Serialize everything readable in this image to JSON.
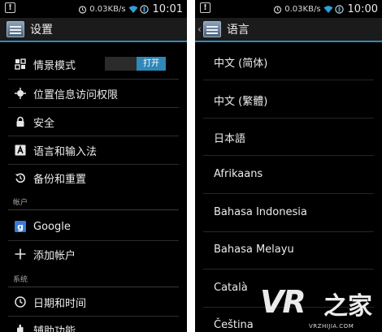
{
  "status_bar": {
    "speed": "0.03KB/s",
    "time": "10:01",
    "time_right": "10:00",
    "warn_glyph": "!"
  },
  "left_screen": {
    "title": "设置",
    "items": [
      {
        "label": "情景模式",
        "icon": "profile-grid-icon",
        "toggle": "打开"
      },
      {
        "label": "位置信息访问权限",
        "icon": "location-icon"
      },
      {
        "label": "安全",
        "icon": "lock-icon"
      },
      {
        "label": "语言和输入法",
        "icon": "keyboard-a-icon"
      },
      {
        "label": "备份和重置",
        "icon": "backup-restore-icon"
      }
    ],
    "section_accounts": "帐户",
    "accounts": [
      {
        "label": "Google",
        "icon": "google-icon"
      },
      {
        "label": "添加帐户",
        "icon": "plus-icon"
      }
    ],
    "section_system": "系统",
    "system": [
      {
        "label": "日期和时间",
        "icon": "clock-icon"
      },
      {
        "label": "辅助功能",
        "icon": "hand-icon"
      }
    ]
  },
  "right_screen": {
    "title": "语言",
    "languages": [
      "中文 (简体)",
      "中文 (繁體)",
      "日本語",
      "Afrikaans",
      "Bahasa Indonesia",
      "Bahasa Melayu",
      "Català",
      "Čeština"
    ]
  },
  "watermark": {
    "brand": "VR",
    "brand_han": "之家",
    "url": "VRZHIJIA.COM"
  },
  "colors": {
    "accent": "#2f88b8",
    "background": "#000000",
    "actionbar": "#1b1b1b"
  }
}
